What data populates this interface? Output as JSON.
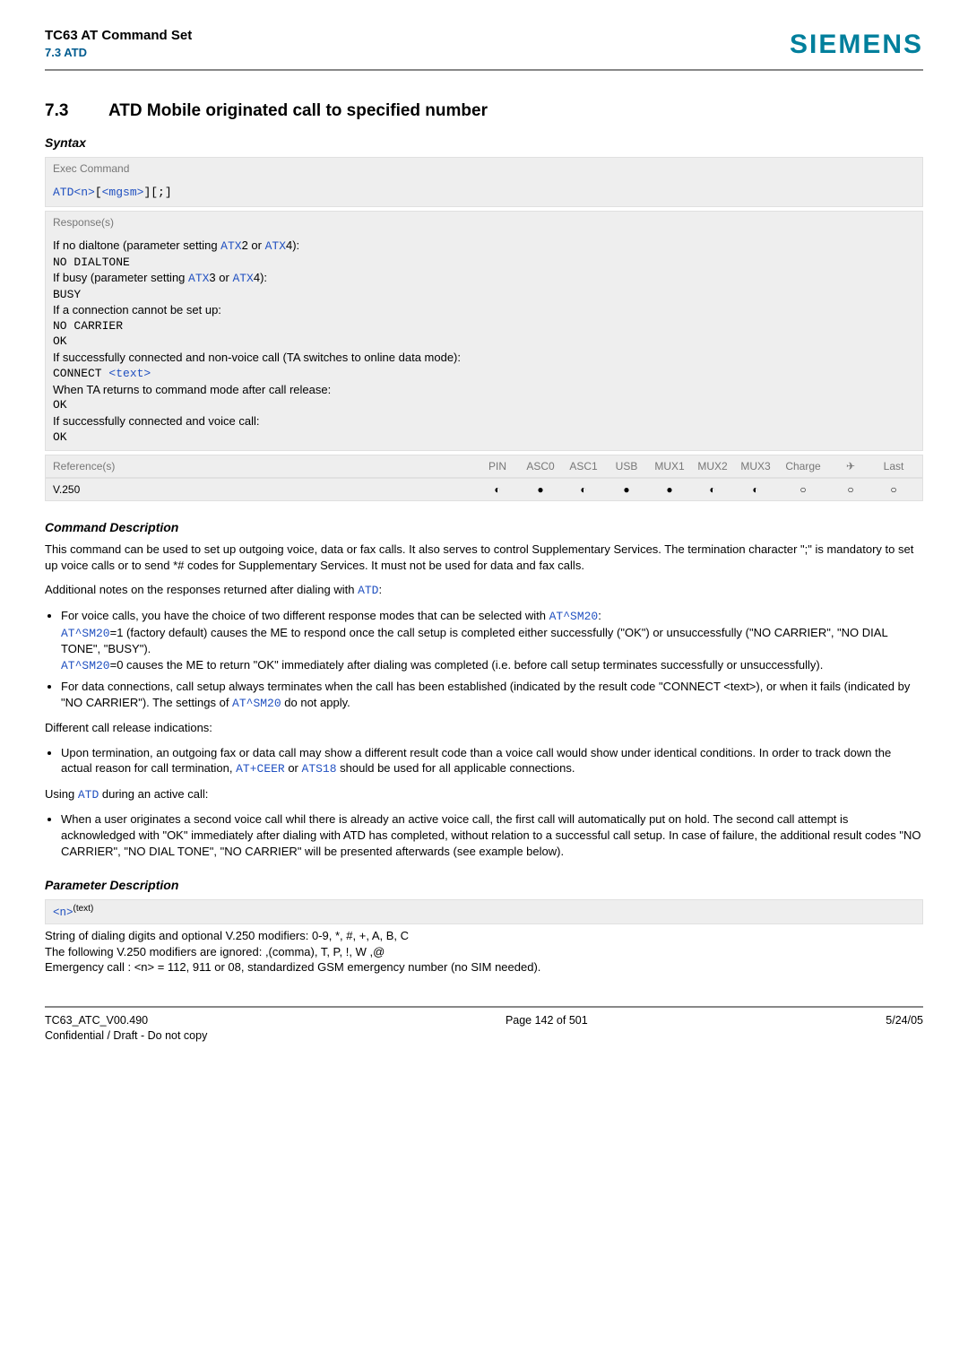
{
  "header": {
    "title": "TC63 AT Command Set",
    "subtitle": "7.3 ATD",
    "logo": "SIEMENS"
  },
  "section": {
    "number": "7.3",
    "title": "ATD   Mobile originated call to specified number"
  },
  "syntax": {
    "label": "Syntax",
    "exec_label": "Exec Command",
    "exec_body_prefix": "ATD",
    "exec_body_n": "<n>",
    "exec_body_lb": "[",
    "exec_body_mgsm": "<mgsm>",
    "exec_body_rb": "]",
    "exec_body_end": "[;]",
    "response_label": "Response(s)",
    "r1": "If no dialtone (parameter setting ",
    "atx2": "ATX",
    "r1b": "2 or ",
    "r1c": "4):",
    "no_dialtone": "NO DIALTONE",
    "r2": "If busy (parameter setting ",
    "r2b": "3 or ",
    "r2c": "4):",
    "busy": "BUSY",
    "r3": "If a connection cannot be set up:",
    "no_carrier": "NO CARRIER",
    "ok": "OK",
    "r4": "If successfully connected and non-voice call (TA switches to online data mode):",
    "connect": "CONNECT ",
    "text_link": "<text>",
    "r5": "When TA returns to command mode after call release:",
    "r6": "If successfully connected and voice call:"
  },
  "ref_table": {
    "ref_label": "Reference(s)",
    "headers": [
      "PIN",
      "ASC0",
      "ASC1",
      "USB",
      "MUX1",
      "MUX2",
      "MUX3",
      "Charge",
      "",
      "Last"
    ],
    "ref_name": "V.250",
    "plane": "✈",
    "dots": [
      "◐",
      "●",
      "◐",
      "●",
      "●",
      "◐",
      "◐",
      "○",
      "○",
      "○"
    ]
  },
  "cmd_desc": {
    "label": "Command Description",
    "p1": "This command can be used to set up outgoing voice, data or fax calls. It also serves to control Supplementary Services. The termination character \";\" is mandatory to set up voice calls or to send *# codes for Supplementary Services. It must not be used for data and fax calls.",
    "p2a": "Additional notes on the responses returned after dialing with ",
    "p2_atd": "ATD",
    "p2b": ":",
    "b1a": "For voice calls, you have the choice of two different response modes that can be selected with ",
    "b1_sm20": "AT^SM20",
    "b1b": ":",
    "b1c": "=1 (factory default) causes the ME to respond once the call setup is completed either successfully (\"OK\") or unsuccessfully (\"NO CARRIER\", \"NO DIAL TONE\", \"BUSY\").",
    "b1d": "=0 causes the ME to return \"OK\" immediately after dialing was completed (i.e. before call setup terminates successfully or unsuccessfully).",
    "b2a": "For data connections, call setup always terminates when the call has been established (indicated by the result code \"CONNECT <text>), or when it fails (indicated by \"NO CARRIER\"). The settings of ",
    "b2b": " do not apply.",
    "p3": "Different call release indications:",
    "b3a": "Upon termination, an outgoing fax or data call may show a different result code than a voice call would show under identical conditions. In order to track down the actual reason for call termination, ",
    "b3_ceer": "AT+CEER",
    "b3_or": " or ",
    "b3_ats18": "ATS18",
    "b3b": " should be used for all applicable connections.",
    "p4a": "Using ",
    "p4b": " during an active call:",
    "b4": "When a user originates a second voice call whil there is already an active voice call, the first call will automatically put on hold. The second call attempt is acknowledged with \"OK\" immediately after dialing with ATD has completed, without relation to a successful call setup. In case of failure, the additional result codes \"NO CARRIER\", \"NO DIAL TONE\", \"NO CARRIER\" will be presented afterwards (see example below)."
  },
  "param_desc": {
    "label": "Parameter Description",
    "n": "<n>",
    "sup": "(text)",
    "l1": "String of dialing digits and optional V.250 modifiers: 0-9, *, #, +, A, B, C",
    "l2": "The following V.250 modifiers are ignored: ,(comma), T, P, !, W ,@",
    "l3": "Emergency call : <n> = 112, 911 or 08, standardized GSM emergency number (no SIM needed)."
  },
  "footer": {
    "left": "TC63_ATC_V00.490",
    "left2": "Confidential / Draft - Do not copy",
    "center": "Page 142 of 501",
    "right": "5/24/05"
  }
}
